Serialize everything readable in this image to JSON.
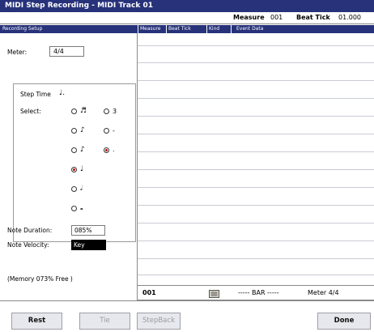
{
  "window": {
    "title": "MIDI Step Recording - MIDI Track 01"
  },
  "position": {
    "measure_label": "Measure",
    "measure_value": "001",
    "beat_tick_label": "Beat Tick",
    "beat_tick_value": "01.000"
  },
  "header": {
    "recording_setup": "Recording Setup",
    "columns": [
      "Measure",
      "Beat Tick",
      "Kind",
      "Event Data"
    ]
  },
  "setup": {
    "meter_label": "Meter:",
    "meter_value": "4/4",
    "step_time_label": "Step Time",
    "step_time_value": "♩.",
    "select_label": "Select:",
    "note_duration_label": "Note Duration:",
    "note_duration_value": "085%",
    "note_velocity_label": "Note Velocity:",
    "note_velocity_value": "Key",
    "memory_text": "(Memory   073% Free   )"
  },
  "note_options": [
    {
      "glyph": "♬",
      "selected": false
    },
    {
      "glyph": "♪",
      "selected": false
    },
    {
      "glyph": "♪",
      "selected": false
    },
    {
      "glyph": "♩",
      "selected": true
    },
    {
      "glyph": "𝅗𝅥",
      "selected": false
    },
    {
      "glyph": "𝅝",
      "selected": false
    }
  ],
  "modifier_options": [
    {
      "glyph": "3",
      "selected": false
    },
    {
      "glyph": "-",
      "selected": false
    },
    {
      "glyph": ".",
      "selected": true
    }
  ],
  "status": {
    "measure": "001",
    "kind_icon": "event-list-icon",
    "event": "----- BAR -----",
    "meter": "Meter  4/4"
  },
  "buttons": {
    "rest": "Rest",
    "tie": "Tie",
    "stepback": "StepBack",
    "done": "Done"
  },
  "colors": {
    "titlebar": "#27327a",
    "selected_radio": "#c01010",
    "velocity_box": "#000000"
  }
}
